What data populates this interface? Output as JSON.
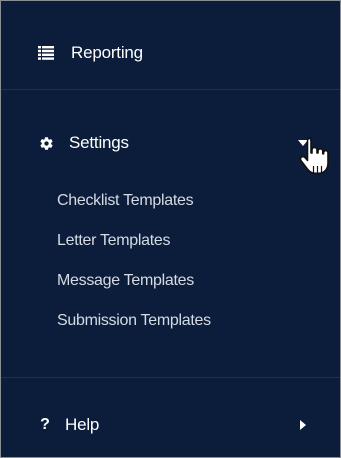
{
  "menu": {
    "reporting": {
      "label": "Reporting",
      "icon": "list-icon"
    },
    "settings": {
      "label": "Settings",
      "icon": "gear-icon",
      "expanded": true,
      "items": [
        {
          "label": "Checklist Templates"
        },
        {
          "label": "Letter Templates"
        },
        {
          "label": "Message Templates"
        },
        {
          "label": "Submission Templates"
        }
      ]
    },
    "help": {
      "label": "Help",
      "icon": "question-icon",
      "icon_glyph": "?"
    }
  },
  "colors": {
    "background": "#0b1d3a",
    "text": "#ffffff",
    "submenu_text": "#d6dbe3"
  }
}
